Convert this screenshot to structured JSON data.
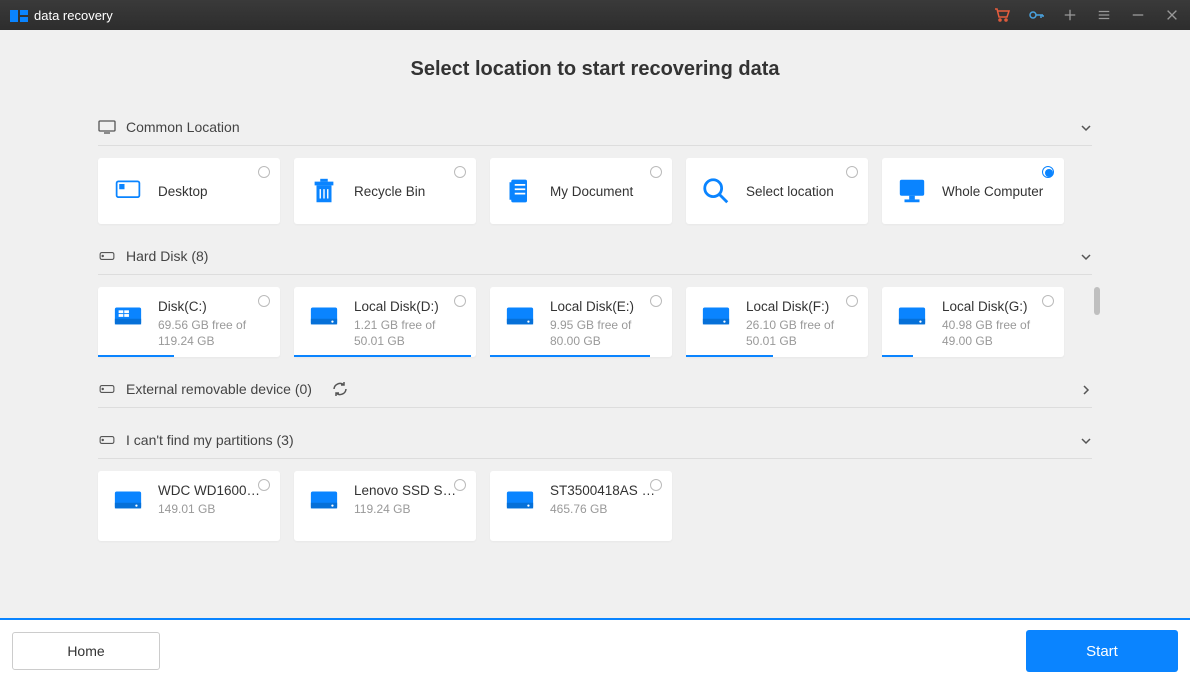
{
  "app": {
    "title": "data recovery"
  },
  "header": {
    "title": "Select location to start recovering data"
  },
  "sections": {
    "common": {
      "label": "Common Location"
    },
    "hard_disk": {
      "label": "Hard Disk (8)"
    },
    "external": {
      "label": "External removable device (0)"
    },
    "lost": {
      "label": "I can't find my partitions (3)"
    }
  },
  "common": [
    {
      "label": "Desktop"
    },
    {
      "label": "Recycle Bin"
    },
    {
      "label": "My Document"
    },
    {
      "label": "Select location"
    },
    {
      "label": "Whole Computer"
    }
  ],
  "disks": [
    {
      "label": "Disk(C:)",
      "sub": "69.56 GB  free of 119.24 GB",
      "progress": 42
    },
    {
      "label": "Local Disk(D:)",
      "sub": "1.21 GB  free of 50.01 GB",
      "progress": 97
    },
    {
      "label": "Local Disk(E:)",
      "sub": "9.95 GB  free of 80.00 GB",
      "progress": 88
    },
    {
      "label": "Local Disk(F:)",
      "sub": "26.10 GB  free of 50.01 GB",
      "progress": 48
    },
    {
      "label": "Local Disk(G:)",
      "sub": "40.98 GB  free of 49.00 GB",
      "progress": 17
    }
  ],
  "lost_partitions": [
    {
      "label": "WDC WD1600A…",
      "sub": "149.01 GB"
    },
    {
      "label": "Lenovo SSD SL…",
      "sub": "119.24 GB"
    },
    {
      "label": "ST3500418AS …",
      "sub": "465.76 GB"
    }
  ],
  "footer": {
    "home": "Home",
    "start": "Start"
  }
}
